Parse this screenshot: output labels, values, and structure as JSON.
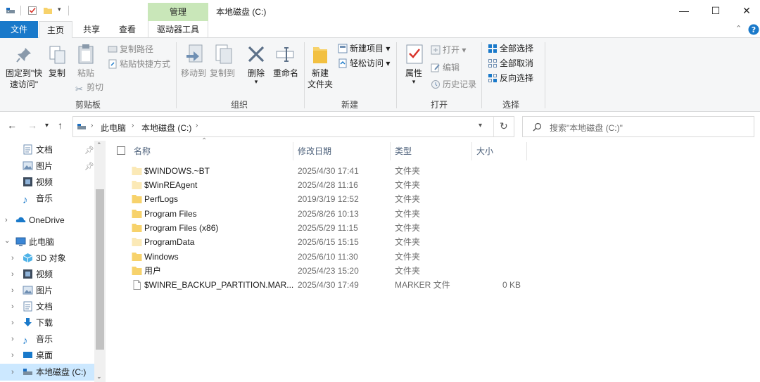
{
  "window": {
    "title": "本地磁盘 (C:)",
    "context_tab": "管理",
    "controls": {
      "minimize": "—",
      "maximize": "☐",
      "close": "✕"
    }
  },
  "ribbon_tabs": {
    "file": "文件",
    "home": "主页",
    "share": "共享",
    "view": "查看",
    "drive_tools": "驱动器工具"
  },
  "ribbon": {
    "clipboard": {
      "label": "剪贴板",
      "pin_line1": "固定到\"快",
      "pin_line2": "速访问\"",
      "copy": "复制",
      "paste": "粘贴",
      "copy_path": "复制路径",
      "paste_shortcut": "粘贴快捷方式",
      "cut": "剪切"
    },
    "organize": {
      "label": "组织",
      "move_to": "移动到",
      "copy_to": "复制到",
      "delete": "删除",
      "rename": "重命名"
    },
    "new": {
      "label": "新建",
      "new_folder_line1": "新建",
      "new_folder_line2": "文件夹",
      "new_item": "新建项目 ▾",
      "easy_access": "轻松访问 ▾"
    },
    "open": {
      "label": "打开",
      "properties": "属性",
      "open": "打开 ▾",
      "edit": "编辑",
      "history": "历史记录"
    },
    "select": {
      "label": "选择",
      "select_all": "全部选择",
      "select_none": "全部取消",
      "invert": "反向选择"
    }
  },
  "address": {
    "crumbs": [
      "此电脑",
      "本地磁盘 (C:)"
    ],
    "search_placeholder": "搜索\"本地磁盘 (C:)\""
  },
  "nav_pane": {
    "quick": [
      "文档",
      "图片",
      "视频",
      "音乐"
    ],
    "onedrive": "OneDrive",
    "this_pc": "此电脑",
    "pc_items": [
      "3D 对象",
      "视频",
      "图片",
      "文档",
      "下载",
      "音乐",
      "桌面",
      "本地磁盘 (C:)"
    ]
  },
  "columns": {
    "name": "名称",
    "date": "修改日期",
    "type": "类型",
    "size": "大小"
  },
  "files": [
    {
      "name": "$WINDOWS.~BT",
      "date": "2025/4/30 17:41",
      "type": "文件夹",
      "size": "",
      "kind": "folder-faded"
    },
    {
      "name": "$WinREAgent",
      "date": "2025/4/28 11:16",
      "type": "文件夹",
      "size": "",
      "kind": "folder-faded"
    },
    {
      "name": "PerfLogs",
      "date": "2019/3/19 12:52",
      "type": "文件夹",
      "size": "",
      "kind": "folder"
    },
    {
      "name": "Program Files",
      "date": "2025/8/26 10:13",
      "type": "文件夹",
      "size": "",
      "kind": "folder"
    },
    {
      "name": "Program Files (x86)",
      "date": "2025/5/29 11:15",
      "type": "文件夹",
      "size": "",
      "kind": "folder"
    },
    {
      "name": "ProgramData",
      "date": "2025/6/15 15:15",
      "type": "文件夹",
      "size": "",
      "kind": "folder-faded"
    },
    {
      "name": "Windows",
      "date": "2025/6/10 11:30",
      "type": "文件夹",
      "size": "",
      "kind": "folder"
    },
    {
      "name": "用户",
      "date": "2025/4/23 15:20",
      "type": "文件夹",
      "size": "",
      "kind": "folder"
    },
    {
      "name": "$WINRE_BACKUP_PARTITION.MAR...",
      "date": "2025/4/30 17:49",
      "type": "MARKER 文件",
      "size": "0 KB",
      "kind": "file"
    }
  ],
  "colors": {
    "file_tab": "#1979ca",
    "manage_tab": "#c9e7b9",
    "folder": "#f7d26b",
    "folder_faded": "#fbe9b6",
    "selection": "#cce8ff"
  }
}
